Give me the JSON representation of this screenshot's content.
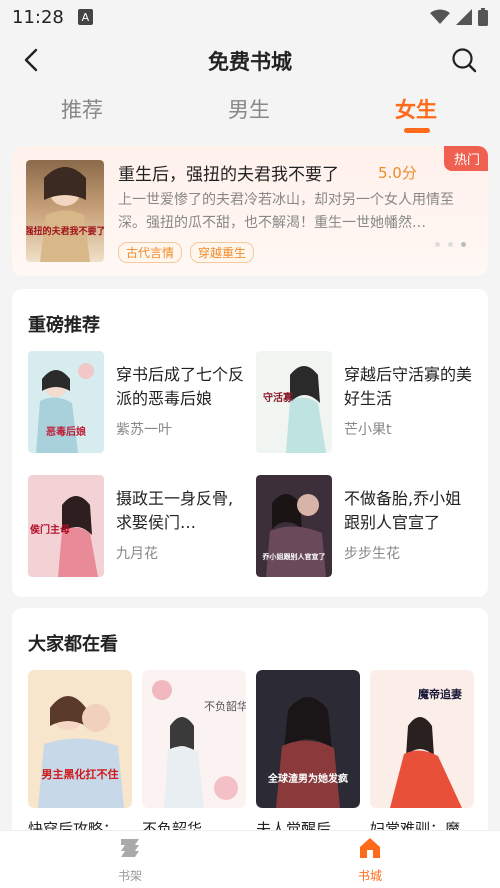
{
  "status_bar": {
    "time": "11:28",
    "notification_icon": "A"
  },
  "header": {
    "title": "免费书城",
    "back_icon": "chevron-left-icon",
    "search_icon": "search-icon"
  },
  "tabs": [
    {
      "label": "推荐",
      "active": false
    },
    {
      "label": "男生",
      "active": false
    },
    {
      "label": "女生",
      "active": true
    }
  ],
  "hot_book": {
    "badge": "热门",
    "title": "重生后，强扭的夫君我不要了",
    "score": "5.0分",
    "description": "上一世爱惨了的夫君冷若冰山，却对另一个女人用情至深。强扭的瓜不甜，也不解渴！重生一世她幡然…",
    "tags": [
      "古代言情",
      "穿越重生"
    ],
    "cover_text": "强扭的夫君我不要了"
  },
  "featured": {
    "title": "重磅推荐",
    "books": [
      {
        "title": "穿书后成了七个反派的恶毒后娘",
        "author": "紫苏一叶",
        "cover_text": "恶毒后娘"
      },
      {
        "title": "穿越后守活寡的美好生活",
        "author": "芒小果t",
        "cover_text": "守活寡"
      },
      {
        "title": "摄政王一身反骨,求娶侯门…",
        "author": "九月花",
        "cover_text": "侯门主母"
      },
      {
        "title": "不做备胎,乔小姐跟别人官宣了",
        "author": "步步生花",
        "cover_text": "乔小姐跟别人官宣了"
      }
    ]
  },
  "popular": {
    "title": "大家都在看",
    "books": [
      {
        "title": "快穿后攻略：",
        "cover_text": "男主黑化扛不住"
      },
      {
        "title": "不负韶华",
        "cover_text": "不负韶华"
      },
      {
        "title": "夫人觉醒后",
        "cover_text": "全球渣男为她发疯"
      },
      {
        "title": "妇常难驯：魔",
        "cover_text": "魔帝追妻"
      }
    ]
  },
  "bottom_nav": [
    {
      "label": "书架",
      "icon": "bookshelf-icon",
      "active": false
    },
    {
      "label": "书城",
      "icon": "home-icon",
      "active": true
    }
  ],
  "colors": {
    "accent": "#ff6a1a",
    "score": "#f08b2a",
    "badge": "#f06050"
  }
}
